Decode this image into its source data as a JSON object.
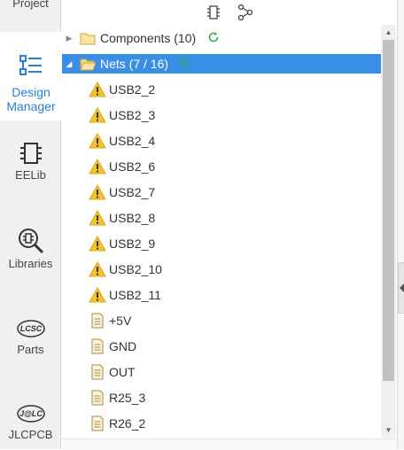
{
  "sidebar": {
    "items": [
      {
        "label": "Project",
        "icon": "project-icon"
      },
      {
        "label": "Design Manager",
        "icon": "design-manager-icon",
        "active": true
      },
      {
        "label": "EELib",
        "icon": "chip-icon"
      },
      {
        "label": "Libraries",
        "icon": "library-search-icon"
      },
      {
        "label": "Parts",
        "icon": "lcsc-icon",
        "icon_text": "LCSC"
      },
      {
        "label": "JLCPCB",
        "icon": "jlc-icon",
        "icon_text": "J@LC"
      }
    ]
  },
  "toolbar": {
    "buttons": [
      "component-icon",
      "net-icon"
    ]
  },
  "tree": {
    "components": {
      "label": "Components (10)",
      "expanded": false
    },
    "nets": {
      "label": "Nets (7 / 16)",
      "expanded": true,
      "items": [
        {
          "label": "USB2_2",
          "warning": true
        },
        {
          "label": "USB2_3",
          "warning": true
        },
        {
          "label": "USB2_4",
          "warning": true
        },
        {
          "label": "USB2_6",
          "warning": true
        },
        {
          "label": "USB2_7",
          "warning": true
        },
        {
          "label": "USB2_8",
          "warning": true
        },
        {
          "label": "USB2_9",
          "warning": true
        },
        {
          "label": "USB2_10",
          "warning": true
        },
        {
          "label": "USB2_11",
          "warning": true
        },
        {
          "label": "+5V",
          "warning": false
        },
        {
          "label": "GND",
          "warning": false
        },
        {
          "label": "OUT",
          "warning": false
        },
        {
          "label": "R25_3",
          "warning": false
        },
        {
          "label": "R26_2",
          "warning": false
        }
      ]
    }
  },
  "colors": {
    "accent": "#2d7fd3",
    "selection": "#3a8ee6",
    "warning": "#f2c230",
    "refresh": "#3aa655"
  }
}
